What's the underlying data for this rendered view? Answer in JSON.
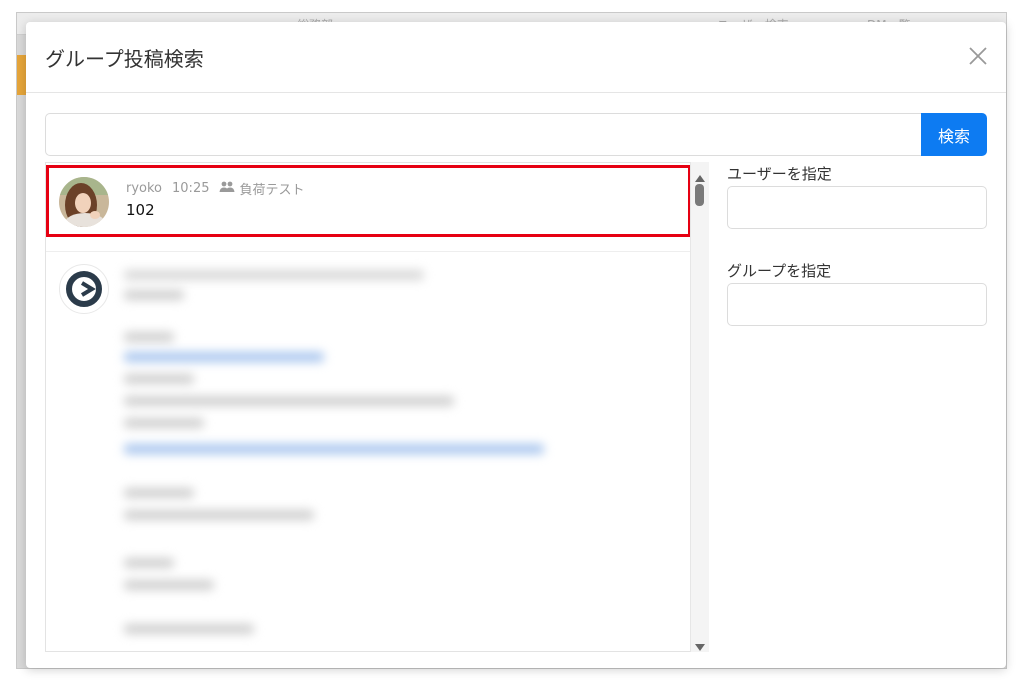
{
  "background_tabs": [
    "",
    "",
    "総務部",
    "",
    "",
    "",
    "ユーザー検索",
    "DM一覧"
  ],
  "modal": {
    "title": "グループ投稿検索",
    "close_icon": "close-icon"
  },
  "search": {
    "value": "",
    "placeholder": "",
    "button_label": "検索"
  },
  "results": [
    {
      "author": "ryoko",
      "time": "10:25",
      "group_icon": "group-icon",
      "group": "負荷テスト",
      "body": "102",
      "highlighted": true
    }
  ],
  "filters": {
    "user_label": "ユーザーを指定",
    "user_value": "",
    "group_label": "グループを指定",
    "group_value": ""
  },
  "colors": {
    "accent": "#0d7bf2",
    "highlight_border": "#e60012"
  }
}
